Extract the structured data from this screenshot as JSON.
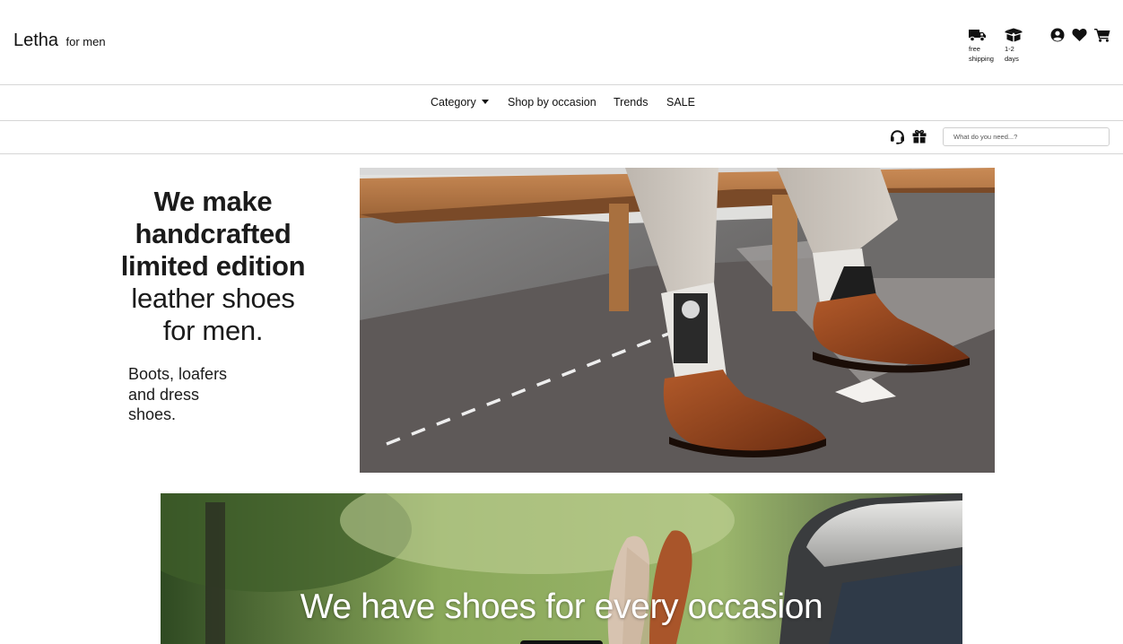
{
  "brand": {
    "name": "Letha",
    "tagline": "for men"
  },
  "features": [
    {
      "icon": "truck-icon",
      "label_line1": "free",
      "label_line2": "shipping"
    },
    {
      "icon": "box-icon",
      "label_line1": "1-2",
      "label_line2": "days"
    }
  ],
  "header_icons": [
    "account-icon",
    "heart-icon",
    "cart-icon"
  ],
  "nav": {
    "category": "Category",
    "occasion": "Shop by occasion",
    "trends": "Trends",
    "sale": "SALE"
  },
  "utility": {
    "icons": [
      "headset-icon",
      "gift-icon"
    ],
    "search_placeholder": "What do you need...?"
  },
  "hero": {
    "line1": "We make",
    "line2": "handcrafted",
    "line3": "limited edition",
    "line4": "leather shoes",
    "line5": "for men.",
    "sub_line1": "Boots, loafers",
    "sub_line2": "and dress",
    "sub_line3": "shoes."
  },
  "banner": {
    "title": "We have shoes for every occasion"
  },
  "colors": {
    "text": "#1b1b1b",
    "border": "#d6d6d6",
    "banner_text": "#ffffff"
  }
}
